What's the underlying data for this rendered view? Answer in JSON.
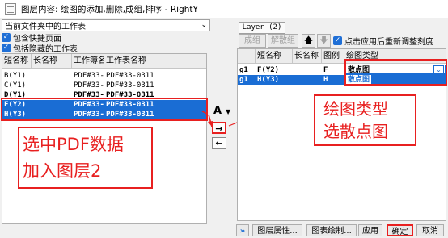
{
  "window": {
    "title": "图层内容: 绘图的添加,删除,成组,排序 - RightY"
  },
  "left": {
    "combo_value": "当前文件夹中的工作表",
    "checkboxes": [
      "包含快捷页面",
      "包括隐藏的工作表"
    ],
    "columns": [
      "短名称",
      "长名称",
      "工作簿名...",
      "工作表名称"
    ],
    "rows": [
      {
        "short": "B(Y1)",
        "long": "",
        "book": "PDF#33-0",
        "sheet": "PDF#33-0311"
      },
      {
        "short": "C(Y1)",
        "long": "",
        "book": "PDF#33-0",
        "sheet": "PDF#33-0311"
      },
      {
        "short": "D(Y1)",
        "long": "",
        "book": "PDF#33-0",
        "sheet": "PDF#33-0311"
      },
      {
        "short": "F(Y2)",
        "long": "",
        "book": "PDF#33-",
        "sheet": "PDF#33-0311"
      },
      {
        "short": "H(Y3)",
        "long": "",
        "book": "PDF#33-",
        "sheet": "PDF#33-0311"
      }
    ]
  },
  "middle": {
    "font_button": "A",
    "add_arrow": "→",
    "remove_arrow": "←"
  },
  "right": {
    "layer_label": "Layer (2)",
    "group_button": "成组",
    "ungroup_button": "解散组",
    "up_icon": "🡅",
    "down_icon": "🡇",
    "rescale_checkbox": "点击应用后重新调整刻度",
    "columns": [
      "短名称",
      "长名称",
      "图例",
      "绘图类型"
    ],
    "rows": [
      {
        "group": "g1",
        "short": "F(Y2)",
        "long": "",
        "legend": "F",
        "plot_type": "散点图"
      },
      {
        "group": "g1",
        "short": "H(Y3)",
        "long": "",
        "legend": "H",
        "plot_type": "散点图"
      }
    ]
  },
  "bottom": {
    "expand": "»",
    "layer_props": "图层属性...",
    "plot_setup": "图表绘制...",
    "apply": "应用",
    "ok": "确定",
    "cancel": "取消"
  },
  "annotations": {
    "left_note_line1": "选中PDF数据",
    "left_note_line2": "加入图层2",
    "right_note_line1": "绘图类型",
    "right_note_line2": "选散点图"
  },
  "colors": {
    "selection": "#1a6dd4",
    "annotation_red": "#e82020",
    "checkbox_blue": "#1f6fd6"
  }
}
